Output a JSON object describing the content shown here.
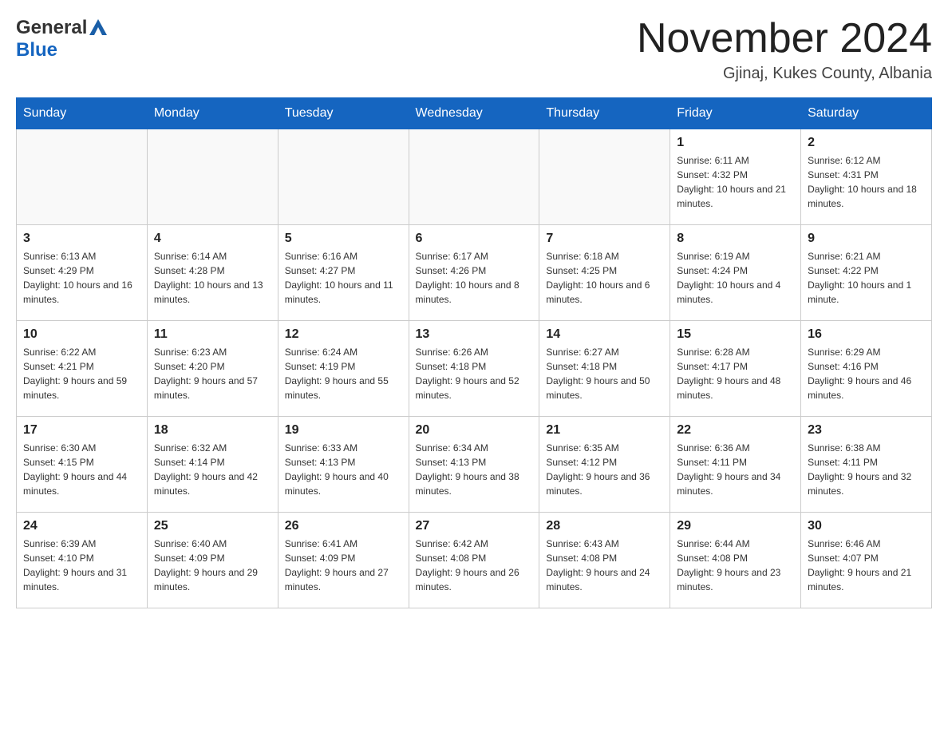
{
  "header": {
    "logo": {
      "general": "General",
      "blue": "Blue",
      "triangle_symbol": "▲"
    },
    "title": "November 2024",
    "location": "Gjinaj, Kukes County, Albania"
  },
  "weekdays": [
    "Sunday",
    "Monday",
    "Tuesday",
    "Wednesday",
    "Thursday",
    "Friday",
    "Saturday"
  ],
  "weeks": [
    [
      {
        "day": "",
        "info": ""
      },
      {
        "day": "",
        "info": ""
      },
      {
        "day": "",
        "info": ""
      },
      {
        "day": "",
        "info": ""
      },
      {
        "day": "",
        "info": ""
      },
      {
        "day": "1",
        "info": "Sunrise: 6:11 AM\nSunset: 4:32 PM\nDaylight: 10 hours and 21 minutes."
      },
      {
        "day": "2",
        "info": "Sunrise: 6:12 AM\nSunset: 4:31 PM\nDaylight: 10 hours and 18 minutes."
      }
    ],
    [
      {
        "day": "3",
        "info": "Sunrise: 6:13 AM\nSunset: 4:29 PM\nDaylight: 10 hours and 16 minutes."
      },
      {
        "day": "4",
        "info": "Sunrise: 6:14 AM\nSunset: 4:28 PM\nDaylight: 10 hours and 13 minutes."
      },
      {
        "day": "5",
        "info": "Sunrise: 6:16 AM\nSunset: 4:27 PM\nDaylight: 10 hours and 11 minutes."
      },
      {
        "day": "6",
        "info": "Sunrise: 6:17 AM\nSunset: 4:26 PM\nDaylight: 10 hours and 8 minutes."
      },
      {
        "day": "7",
        "info": "Sunrise: 6:18 AM\nSunset: 4:25 PM\nDaylight: 10 hours and 6 minutes."
      },
      {
        "day": "8",
        "info": "Sunrise: 6:19 AM\nSunset: 4:24 PM\nDaylight: 10 hours and 4 minutes."
      },
      {
        "day": "9",
        "info": "Sunrise: 6:21 AM\nSunset: 4:22 PM\nDaylight: 10 hours and 1 minute."
      }
    ],
    [
      {
        "day": "10",
        "info": "Sunrise: 6:22 AM\nSunset: 4:21 PM\nDaylight: 9 hours and 59 minutes."
      },
      {
        "day": "11",
        "info": "Sunrise: 6:23 AM\nSunset: 4:20 PM\nDaylight: 9 hours and 57 minutes."
      },
      {
        "day": "12",
        "info": "Sunrise: 6:24 AM\nSunset: 4:19 PM\nDaylight: 9 hours and 55 minutes."
      },
      {
        "day": "13",
        "info": "Sunrise: 6:26 AM\nSunset: 4:18 PM\nDaylight: 9 hours and 52 minutes."
      },
      {
        "day": "14",
        "info": "Sunrise: 6:27 AM\nSunset: 4:18 PM\nDaylight: 9 hours and 50 minutes."
      },
      {
        "day": "15",
        "info": "Sunrise: 6:28 AM\nSunset: 4:17 PM\nDaylight: 9 hours and 48 minutes."
      },
      {
        "day": "16",
        "info": "Sunrise: 6:29 AM\nSunset: 4:16 PM\nDaylight: 9 hours and 46 minutes."
      }
    ],
    [
      {
        "day": "17",
        "info": "Sunrise: 6:30 AM\nSunset: 4:15 PM\nDaylight: 9 hours and 44 minutes."
      },
      {
        "day": "18",
        "info": "Sunrise: 6:32 AM\nSunset: 4:14 PM\nDaylight: 9 hours and 42 minutes."
      },
      {
        "day": "19",
        "info": "Sunrise: 6:33 AM\nSunset: 4:13 PM\nDaylight: 9 hours and 40 minutes."
      },
      {
        "day": "20",
        "info": "Sunrise: 6:34 AM\nSunset: 4:13 PM\nDaylight: 9 hours and 38 minutes."
      },
      {
        "day": "21",
        "info": "Sunrise: 6:35 AM\nSunset: 4:12 PM\nDaylight: 9 hours and 36 minutes."
      },
      {
        "day": "22",
        "info": "Sunrise: 6:36 AM\nSunset: 4:11 PM\nDaylight: 9 hours and 34 minutes."
      },
      {
        "day": "23",
        "info": "Sunrise: 6:38 AM\nSunset: 4:11 PM\nDaylight: 9 hours and 32 minutes."
      }
    ],
    [
      {
        "day": "24",
        "info": "Sunrise: 6:39 AM\nSunset: 4:10 PM\nDaylight: 9 hours and 31 minutes."
      },
      {
        "day": "25",
        "info": "Sunrise: 6:40 AM\nSunset: 4:09 PM\nDaylight: 9 hours and 29 minutes."
      },
      {
        "day": "26",
        "info": "Sunrise: 6:41 AM\nSunset: 4:09 PM\nDaylight: 9 hours and 27 minutes."
      },
      {
        "day": "27",
        "info": "Sunrise: 6:42 AM\nSunset: 4:08 PM\nDaylight: 9 hours and 26 minutes."
      },
      {
        "day": "28",
        "info": "Sunrise: 6:43 AM\nSunset: 4:08 PM\nDaylight: 9 hours and 24 minutes."
      },
      {
        "day": "29",
        "info": "Sunrise: 6:44 AM\nSunset: 4:08 PM\nDaylight: 9 hours and 23 minutes."
      },
      {
        "day": "30",
        "info": "Sunrise: 6:46 AM\nSunset: 4:07 PM\nDaylight: 9 hours and 21 minutes."
      }
    ]
  ]
}
